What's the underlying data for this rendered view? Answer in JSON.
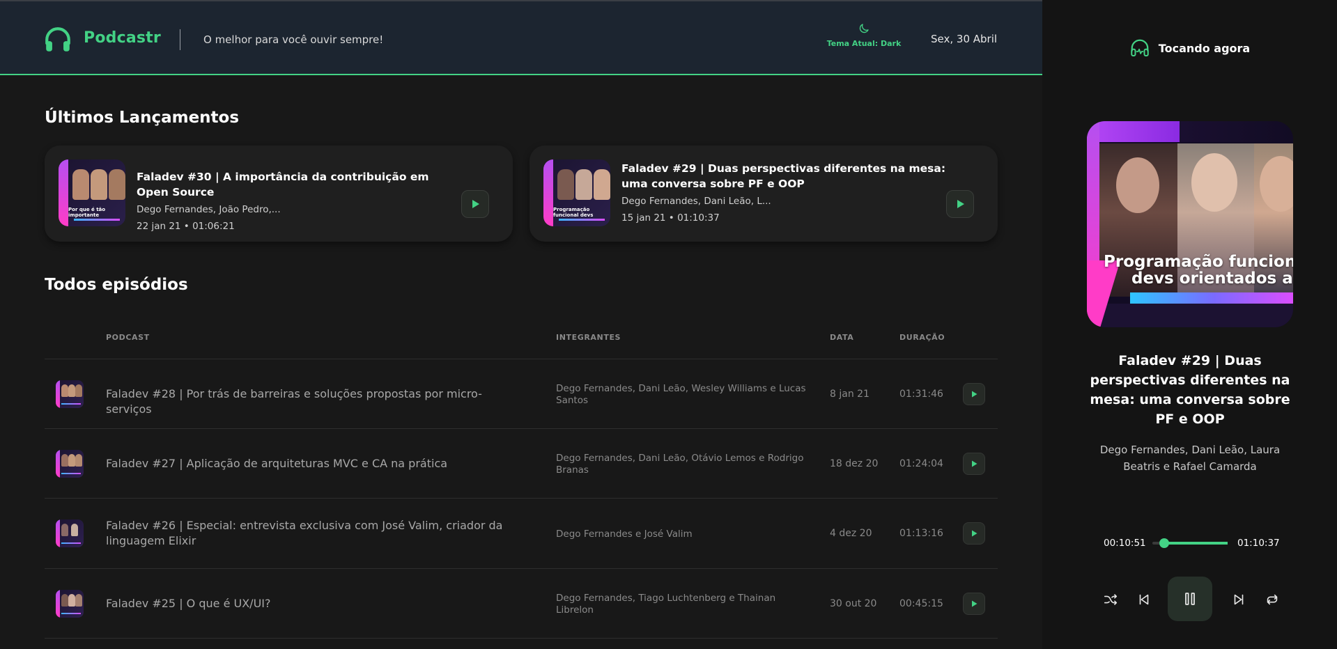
{
  "header": {
    "logo": "Podcastr",
    "tagline": "O melhor para você ouvir sempre!",
    "theme_label": "Tema Atual: Dark",
    "date": "Sex, 30 Abril"
  },
  "latest": {
    "title": "Últimos Lançamentos",
    "episodes": [
      {
        "title": "Faladev #30 | A importância da contribuição em Open Source",
        "members": "Dego Fernandes, João Pedro,...",
        "meta": "22 jan 21 • 01:06:21",
        "thumb_caption": "Por que é tão importante contribuir em Open Source"
      },
      {
        "title": "Faladev #29 | Duas perspectivas diferentes na mesa: uma conversa sobre PF e OOP",
        "members": "Dego Fernandes, Dani Leão, L...",
        "meta": "15 jan 21 • 01:10:37",
        "thumb_caption": "Programação funcional devs orientados a o"
      }
    ]
  },
  "all": {
    "title": "Todos episódios",
    "columns": [
      "PODCAST",
      "INTEGRANTES",
      "DATA",
      "DURAÇÃO"
    ],
    "rows": [
      {
        "title": "Faladev #28 | Por trás de barreiras e soluções propostas por micro-serviços",
        "members": "Dego Fernandes, Dani Leão, Wesley Williams e Lucas Santos",
        "date": "8 jan 21",
        "duration": "01:31:46"
      },
      {
        "title": "Faladev #27 | Aplicação de arquiteturas MVC e CA na prática",
        "members": "Dego Fernandes, Dani Leão, Otávio Lemos e Rodrigo Branas",
        "date": "18 dez 20",
        "duration": "01:24:04"
      },
      {
        "title": "Faladev #26 | Especial: entrevista exclusiva com José Valim, criador da linguagem Elixir",
        "members": "Dego Fernandes e José Valim",
        "date": "4 dez 20",
        "duration": "01:13:16"
      },
      {
        "title": "Faladev #25 | O que é UX/UI?",
        "members": "Dego Fernandes, Tiago Luchtenberg e Thainan Librelon",
        "date": "30 out 20",
        "duration": "00:45:15"
      }
    ]
  },
  "player": {
    "label": "Tocando agora",
    "cover_text_1": "Programação funcion",
    "cover_text_2": "devs orientados a o",
    "title": "Faladev #29 | Duas perspectivas diferentes na mesa: uma conversa sobre PF e OOP",
    "members": "Dego Fernandes, Dani Leão, Laura Beatris e Rafael Camarda",
    "current_time": "00:10:51",
    "total_time": "01:10:37",
    "progress_fraction": 0.1537
  },
  "colors": {
    "accent": "#43d285",
    "background": "#181818",
    "header_bg": "#1c2530",
    "player_bg": "#141414",
    "card_bg": "#1f1f1f",
    "muted_text": "#8a8a8a"
  },
  "icons": {
    "logo": "headphones-icon",
    "theme": "moon-icon",
    "now_playing": "headphones-playing-icon",
    "play": "play-icon",
    "shuffle": "shuffle-icon",
    "previous": "skip-previous-icon",
    "pause": "pause-icon",
    "next": "skip-next-icon",
    "repeat": "repeat-icon"
  }
}
